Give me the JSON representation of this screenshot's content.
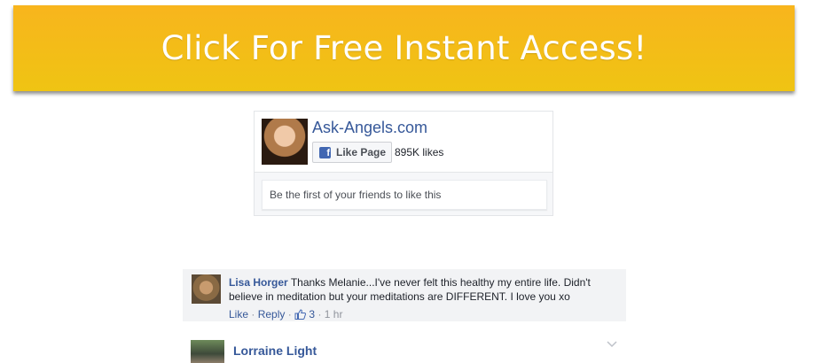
{
  "cta": {
    "label": "Click For Free Instant Access!",
    "bg_color": "#f4bc18"
  },
  "fb_plugin": {
    "page_name": "Ask-Angels.com",
    "like_button_label": "Like Page",
    "likes_count": "895K likes",
    "friends_text": "Be the first of your friends to like this",
    "brand_color": "#4267b2"
  },
  "comments": [
    {
      "author": "Lisa Horger",
      "text": "Thanks Melanie...I've never felt this healthy my entire life. Didn't believe in meditation but your meditations are DIFFERENT. I love you xo",
      "like_label": "Like",
      "reply_label": "Reply",
      "reactions": "3",
      "time": "1 hr"
    },
    {
      "author": "Lorraine Light"
    }
  ]
}
